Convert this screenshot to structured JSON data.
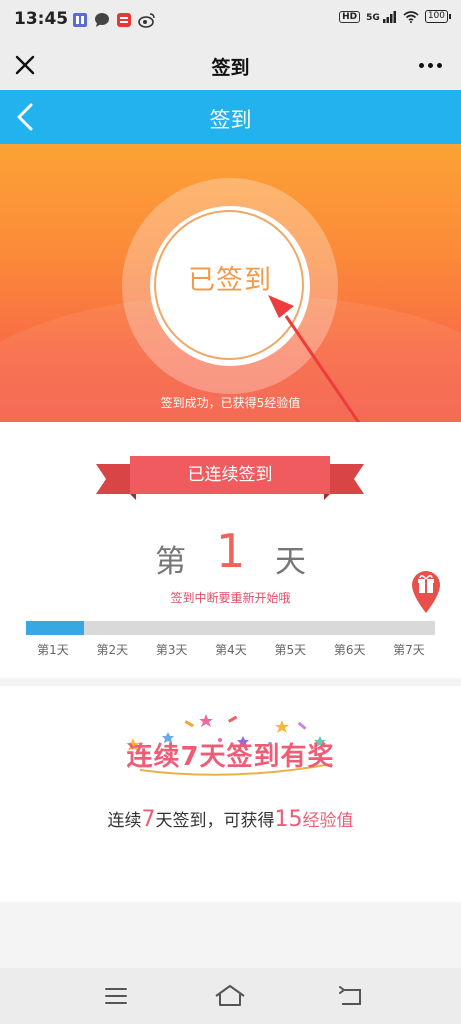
{
  "status_bar": {
    "time": "13:45",
    "icons": [
      "app-icon",
      "message-icon",
      "red-app-icon",
      "weibo-icon",
      "hd-icon",
      "5g-signal-icon",
      "wifi-icon",
      "battery-icon"
    ],
    "network": "5G",
    "hd": "HD",
    "battery": "100"
  },
  "titlebar": {
    "title": "签到"
  },
  "header": {
    "title": "签到",
    "color": "#22b2ee"
  },
  "hero": {
    "button_label": "已签到",
    "message": "签到成功，已获得5经验值",
    "colors": {
      "top": "#fca234",
      "bottom": "#f45f4b"
    }
  },
  "streak": {
    "ribbon_label": "已连续签到",
    "day_prefix": "第",
    "day_count": "1",
    "day_suffix": "天",
    "notice": "签到中断要重新开始哦",
    "progress_days_done": 1,
    "progress_days_total": 7,
    "day_labels": [
      "第1天",
      "第2天",
      "第3天",
      "第4天",
      "第5天",
      "第6天",
      "第7天"
    ]
  },
  "reward": {
    "title": "连续7天签到有奖",
    "text_part1": "连续",
    "text_num1": "7",
    "text_part2": "天签到，可获得",
    "text_num2": "15",
    "text_part3": "经验值",
    "accent": "#f05c75"
  },
  "navbar": {
    "icons": [
      "menu-icon",
      "home-icon",
      "back-icon"
    ]
  }
}
